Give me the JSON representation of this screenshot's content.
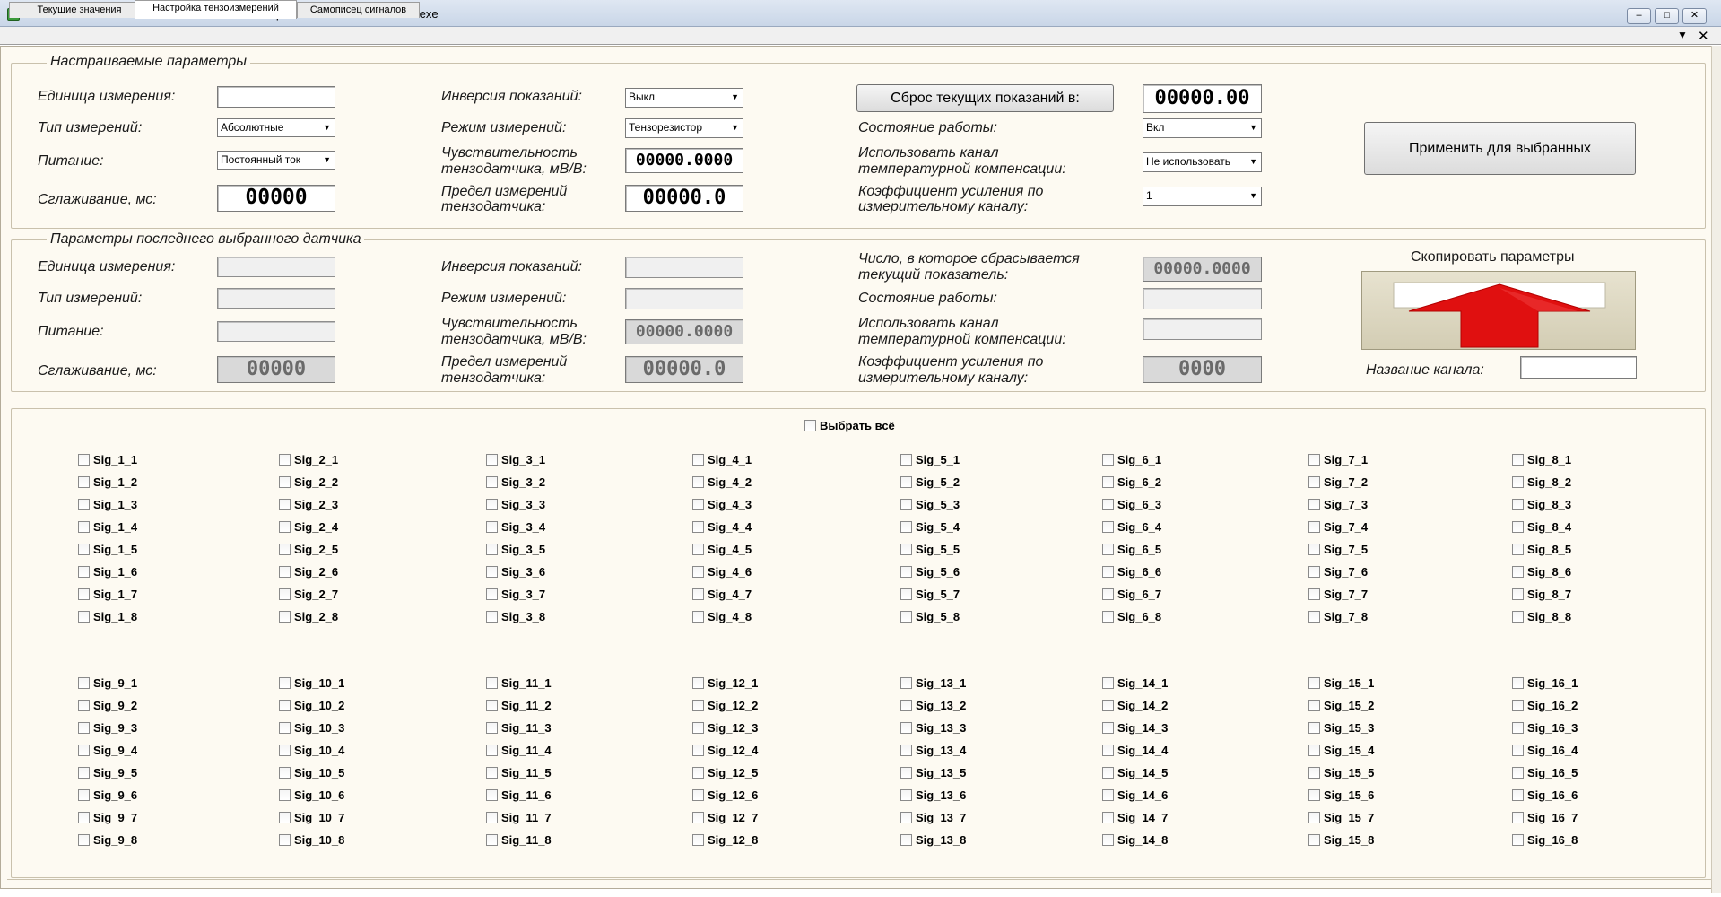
{
  "window": {
    "title": "SCADA-система ZETVIEW c:\\users\\user\\desktop\\multi-channel tenzometer.exe",
    "icon": "zetview-app-icon",
    "controls": [
      "minimize-icon",
      "maximize-icon",
      "close-icon"
    ]
  },
  "tabs": [
    {
      "label": "Текущие значения",
      "active": false
    },
    {
      "label": "Настройка тензоизмерений",
      "active": true
    },
    {
      "label": "Самописец сигналов",
      "active": false
    }
  ],
  "configurable": {
    "group_title": "Настраиваемые параметры",
    "unit_label": "Единица измерения:",
    "unit_value": "",
    "type_label": "Тип измерений:",
    "type_value": "Абсолютные",
    "power_label": "Питание:",
    "power_value": "Постоянный ток",
    "smoothing_label": "Сглаживание, мс:",
    "smoothing_value": "00000",
    "inversion_label": "Инверсия показаний:",
    "inversion_value": "Выкл",
    "mode_label": "Режим измерений:",
    "mode_value": "Тензорезистор",
    "sensitivity_label_1": "Чувствительность",
    "sensitivity_label_2": "тензодатчика, мВ/В:",
    "sensitivity_value": "00000.0000",
    "limit_label_1": "Предел измерений",
    "limit_label_2": "тензодатчика:",
    "limit_value": "00000.0",
    "reset_button": "Сброс текущих показаний в:",
    "reset_value": "00000.00",
    "state_label": "Состояние работы:",
    "state_value": "Вкл",
    "tempcomp_label_1": "Использовать канал",
    "tempcomp_label_2": "температурной компенсации:",
    "tempcomp_value": "Не использовать",
    "gain_label_1": "Коэффициент усиления по",
    "gain_label_2": "измерительному каналу:",
    "gain_value": "1",
    "apply_button": "Применить для выбранных"
  },
  "last_sensor": {
    "group_title": "Параметры последнего выбранного датчика",
    "unit_label": "Единица измерения:",
    "type_label": "Тип измерений:",
    "power_label": "Питание:",
    "smoothing_label": "Сглаживание, мс:",
    "smoothing_value": "00000",
    "inversion_label": "Инверсия показаний:",
    "mode_label": "Режим измерений:",
    "sensitivity_label_1": "Чувствительность",
    "sensitivity_label_2": "тензодатчика, мВ/В:",
    "sensitivity_value": "00000.0000",
    "limit_label_1": "Предел измерений",
    "limit_label_2": "тензодатчика:",
    "limit_value": "00000.0",
    "reset_label_1": "Число, в которое сбрасывается",
    "reset_label_2": "текущий показатель:",
    "reset_value": "00000.0000",
    "state_label": "Состояние работы:",
    "tempcomp_label_1": "Использовать канал",
    "tempcomp_label_2": "температурной компенсации:",
    "gain_label_1": "Коэффициент усиления по",
    "gain_label_2": "измерительному каналу:",
    "gain_value": "0000",
    "copy_label": "Скопировать параметры",
    "copy_icon": "up-arrow-icon",
    "channel_name_label": "Название канала:",
    "channel_name_value": ""
  },
  "channels": {
    "select_all_label": "Выбрать всё",
    "groups": [
      [
        "Sig_1_1",
        "Sig_1_2",
        "Sig_1_3",
        "Sig_1_4",
        "Sig_1_5",
        "Sig_1_6",
        "Sig_1_7",
        "Sig_1_8"
      ],
      [
        "Sig_2_1",
        "Sig_2_2",
        "Sig_2_3",
        "Sig_2_4",
        "Sig_2_5",
        "Sig_2_6",
        "Sig_2_7",
        "Sig_2_8"
      ],
      [
        "Sig_3_1",
        "Sig_3_2",
        "Sig_3_3",
        "Sig_3_4",
        "Sig_3_5",
        "Sig_3_6",
        "Sig_3_7",
        "Sig_3_8"
      ],
      [
        "Sig_4_1",
        "Sig_4_2",
        "Sig_4_3",
        "Sig_4_4",
        "Sig_4_5",
        "Sig_4_6",
        "Sig_4_7",
        "Sig_4_8"
      ],
      [
        "Sig_5_1",
        "Sig_5_2",
        "Sig_5_3",
        "Sig_5_4",
        "Sig_5_5",
        "Sig_5_6",
        "Sig_5_7",
        "Sig_5_8"
      ],
      [
        "Sig_6_1",
        "Sig_6_2",
        "Sig_6_3",
        "Sig_6_4",
        "Sig_6_5",
        "Sig_6_6",
        "Sig_6_7",
        "Sig_6_8"
      ],
      [
        "Sig_7_1",
        "Sig_7_2",
        "Sig_7_3",
        "Sig_7_4",
        "Sig_7_5",
        "Sig_7_6",
        "Sig_7_7",
        "Sig_7_8"
      ],
      [
        "Sig_8_1",
        "Sig_8_2",
        "Sig_8_3",
        "Sig_8_4",
        "Sig_8_5",
        "Sig_8_6",
        "Sig_8_7",
        "Sig_8_8"
      ],
      [
        "Sig_9_1",
        "Sig_9_2",
        "Sig_9_3",
        "Sig_9_4",
        "Sig_9_5",
        "Sig_9_6",
        "Sig_9_7",
        "Sig_9_8"
      ],
      [
        "Sig_10_1",
        "Sig_10_2",
        "Sig_10_3",
        "Sig_10_4",
        "Sig_10_5",
        "Sig_10_6",
        "Sig_10_7",
        "Sig_10_8"
      ],
      [
        "Sig_11_1",
        "Sig_11_2",
        "Sig_11_3",
        "Sig_11_4",
        "Sig_11_5",
        "Sig_11_6",
        "Sig_11_7",
        "Sig_11_8"
      ],
      [
        "Sig_12_1",
        "Sig_12_2",
        "Sig_12_3",
        "Sig_12_4",
        "Sig_12_5",
        "Sig_12_6",
        "Sig_12_7",
        "Sig_12_8"
      ],
      [
        "Sig_13_1",
        "Sig_13_2",
        "Sig_13_3",
        "Sig_13_4",
        "Sig_13_5",
        "Sig_13_6",
        "Sig_13_7",
        "Sig_13_8"
      ],
      [
        "Sig_14_1",
        "Sig_14_2",
        "Sig_14_3",
        "Sig_14_4",
        "Sig_14_5",
        "Sig_14_6",
        "Sig_14_7",
        "Sig_14_8"
      ],
      [
        "Sig_15_1",
        "Sig_15_2",
        "Sig_15_3",
        "Sig_15_4",
        "Sig_15_5",
        "Sig_15_6",
        "Sig_15_7",
        "Sig_15_8"
      ],
      [
        "Sig_16_1",
        "Sig_16_2",
        "Sig_16_3",
        "Sig_16_4",
        "Sig_16_5",
        "Sig_16_6",
        "Sig_16_7",
        "Sig_16_8"
      ]
    ]
  },
  "colors": {
    "panel_bg": "#fdfaf2",
    "arrow_red": "#e01010",
    "arrow_box": "#d3cdb4"
  }
}
